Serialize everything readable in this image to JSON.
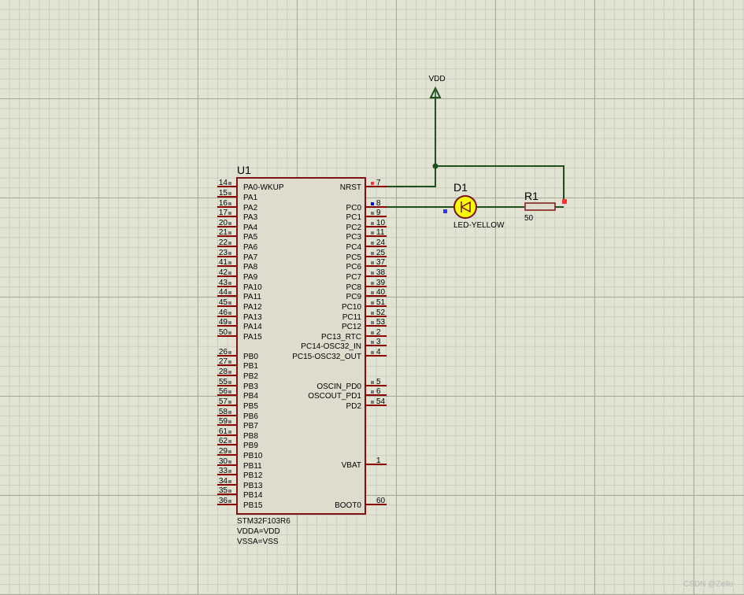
{
  "component_u1": {
    "ref": "U1",
    "part": "STM32F103R6",
    "props": [
      "VDDA=VDD",
      "VSSA=VSS"
    ],
    "left_pins": [
      {
        "name": "PA0-WKUP",
        "num": "14"
      },
      {
        "name": "PA1",
        "num": "15"
      },
      {
        "name": "PA2",
        "num": "16"
      },
      {
        "name": "PA3",
        "num": "17"
      },
      {
        "name": "PA4",
        "num": "20"
      },
      {
        "name": "PA5",
        "num": "21"
      },
      {
        "name": "PA6",
        "num": "22"
      },
      {
        "name": "PA7",
        "num": "23"
      },
      {
        "name": "PA8",
        "num": "41"
      },
      {
        "name": "PA9",
        "num": "42"
      },
      {
        "name": "PA10",
        "num": "43"
      },
      {
        "name": "PA11",
        "num": "44"
      },
      {
        "name": "PA12",
        "num": "45"
      },
      {
        "name": "PA13",
        "num": "46"
      },
      {
        "name": "PA14",
        "num": "49"
      },
      {
        "name": "PA15",
        "num": "50"
      },
      {
        "name": "PB0",
        "num": "26"
      },
      {
        "name": "PB1",
        "num": "27"
      },
      {
        "name": "PB2",
        "num": "28"
      },
      {
        "name": "PB3",
        "num": "55"
      },
      {
        "name": "PB4",
        "num": "56"
      },
      {
        "name": "PB5",
        "num": "57"
      },
      {
        "name": "PB6",
        "num": "58"
      },
      {
        "name": "PB7",
        "num": "59"
      },
      {
        "name": "PB8",
        "num": "61"
      },
      {
        "name": "PB9",
        "num": "62"
      },
      {
        "name": "PB10",
        "num": "29"
      },
      {
        "name": "PB11",
        "num": "30"
      },
      {
        "name": "PB12",
        "num": "33"
      },
      {
        "name": "PB13",
        "num": "34"
      },
      {
        "name": "PB14",
        "num": "35"
      },
      {
        "name": "PB15",
        "num": "36"
      }
    ],
    "right_pins": [
      {
        "name": "NRST",
        "num": "7"
      },
      {
        "name": "PC0",
        "num": "8"
      },
      {
        "name": "PC1",
        "num": "9"
      },
      {
        "name": "PC2",
        "num": "10"
      },
      {
        "name": "PC3",
        "num": "11"
      },
      {
        "name": "PC4",
        "num": "24"
      },
      {
        "name": "PC5",
        "num": "25"
      },
      {
        "name": "PC6",
        "num": "37"
      },
      {
        "name": "PC7",
        "num": "38"
      },
      {
        "name": "PC8",
        "num": "39"
      },
      {
        "name": "PC9",
        "num": "40"
      },
      {
        "name": "PC10",
        "num": "51"
      },
      {
        "name": "PC11",
        "num": "52"
      },
      {
        "name": "PC12",
        "num": "53"
      },
      {
        "name": "PC13_RTC",
        "num": "2"
      },
      {
        "name": "PC14-OSC32_IN",
        "num": "3"
      },
      {
        "name": "PC15-OSC32_OUT",
        "num": "4"
      },
      {
        "name": "OSCIN_PD0",
        "num": "5"
      },
      {
        "name": "OSCOUT_PD1",
        "num": "6"
      },
      {
        "name": "PD2",
        "num": "54"
      },
      {
        "name": "VBAT",
        "num": "1"
      },
      {
        "name": "BOOT0",
        "num": "60"
      }
    ]
  },
  "component_d1": {
    "ref": "D1",
    "value": "LED-YELLOW"
  },
  "component_r1": {
    "ref": "R1",
    "value": "50"
  },
  "power_vdd": {
    "label": "VDD"
  },
  "watermark": "CSDN @Zello",
  "colors": {
    "wire": "#1f4e1f",
    "pin": "#8b0000",
    "body_fill": "#e0dccd",
    "body_border": "#7a1414",
    "led_fill": "#ffff00",
    "pin_active": "#ff3333",
    "pin_inactive": "#0000ff",
    "stub": "#7a7a7a"
  }
}
